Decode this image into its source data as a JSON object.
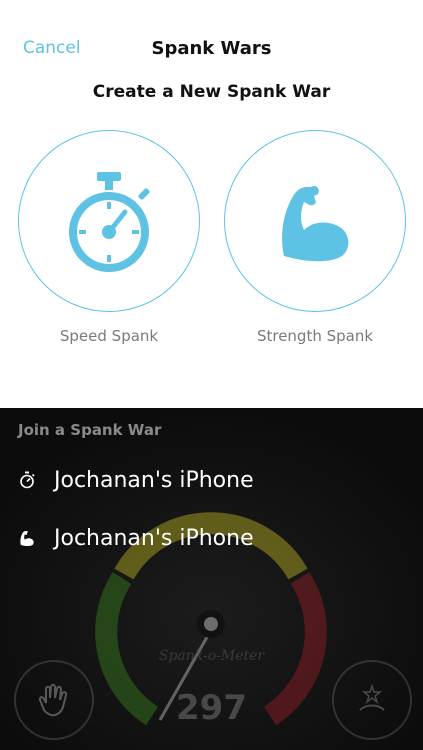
{
  "nav": {
    "cancel_label": "Cancel",
    "title": "Spank Wars"
  },
  "create": {
    "heading": "Create a New Spank War",
    "options": [
      {
        "label": "Speed Spank",
        "icon": "stopwatch-icon"
      },
      {
        "label": "Strength Spank",
        "icon": "flexed-arm-icon"
      }
    ]
  },
  "join": {
    "heading": "Join a Spank War",
    "items": [
      {
        "name": "Jochanan's iPhone",
        "icon": "stopwatch-icon"
      },
      {
        "name": "Jochanan's iPhone",
        "icon": "flexed-arm-icon"
      }
    ]
  },
  "meter": {
    "brand": "Spank-o-Meter",
    "count": "297"
  },
  "colors": {
    "accent": "#5ec2e5",
    "dark_background": "#121212",
    "gauge_green": "#3a8a1e",
    "gauge_yellow": "#c9c024",
    "gauge_red": "#a0202a"
  }
}
